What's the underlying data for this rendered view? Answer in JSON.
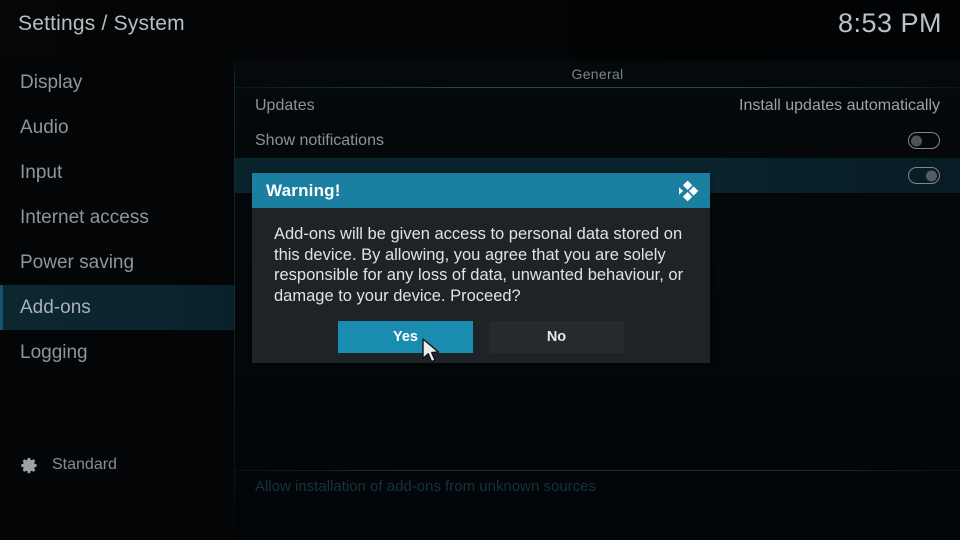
{
  "header": {
    "breadcrumb": "Settings / System",
    "clock": "8:53 PM"
  },
  "sidebar": {
    "items": [
      {
        "label": "Display",
        "selected": false
      },
      {
        "label": "Audio",
        "selected": false
      },
      {
        "label": "Input",
        "selected": false
      },
      {
        "label": "Internet access",
        "selected": false
      },
      {
        "label": "Power saving",
        "selected": false
      },
      {
        "label": "Add-ons",
        "selected": true
      },
      {
        "label": "Logging",
        "selected": false
      }
    ],
    "profile": {
      "icon": "gear-icon",
      "label": "Standard"
    }
  },
  "content": {
    "section_title": "General",
    "rows": [
      {
        "label": "Updates",
        "value": "Install updates automatically",
        "control": "text",
        "selected": false
      },
      {
        "label": "Show notifications",
        "value": "",
        "control": "toggle",
        "toggle_state": "off",
        "selected": false
      },
      {
        "label": "",
        "value": "",
        "control": "toggle",
        "toggle_state": "on",
        "selected": true
      }
    ],
    "footer_help": "Allow installation of add-ons from unknown sources"
  },
  "dialog": {
    "title": "Warning!",
    "logo": "kodi-logo",
    "message": "Add-ons will be given access to personal data stored on this device. By allowing, you agree that you are solely responsible for any loss of data, unwanted behaviour, or damage to your device. Proceed?",
    "buttons": [
      {
        "label": "Yes",
        "focused": true
      },
      {
        "label": "No",
        "focused": false
      }
    ]
  },
  "colors": {
    "accent": "#1a8cb0",
    "header_bar": "#1a7fa0",
    "dialog_body": "#1d2326",
    "selection": "#0a242d",
    "background": "#030405"
  }
}
